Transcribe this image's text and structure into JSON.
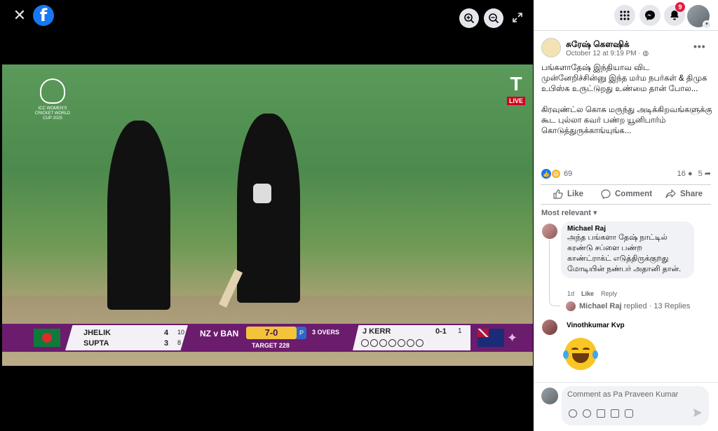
{
  "viewer": {
    "close_icon": "close-icon",
    "brand": "f",
    "photo": {
      "broadcast_logo": "ICC WOMEN'S CRICKET WORLD CUP 2025",
      "live_badge": "LIVE",
      "scorebar": {
        "batter1": {
          "name": "JHELIK",
          "runs": "4",
          "balls": "10"
        },
        "batter2": {
          "name": "SUPTA",
          "runs": "3",
          "balls": "8"
        },
        "match": "NZ v BAN",
        "score": "7-0",
        "powerplay": "P",
        "overs": "3 OVERS",
        "target": "TARGET 228",
        "bowler": {
          "name": "J KERR",
          "figures": "0-1",
          "overs": "1"
        }
      }
    }
  },
  "header": {
    "notifications_count": "9",
    "icons": [
      "menu-icon",
      "messenger-icon",
      "bell-icon"
    ]
  },
  "post": {
    "author": "சுரேஷ் கௌஷிக்",
    "timestamp": "October 12 at 9:19 PM",
    "privacy_icon": "globe-icon",
    "text": "பங்களாதேஷ் இந்தியாவ விட முன்னேறிச்சின்னு இந்த மர்ம நபர்கள் & திமுக உபிஸ்க உருட்டுறது உண்மை தான் போல...\n\nகிரவுண்ட்ல கொசு மருந்து அடிக்கிறவங்களுக்கு கூட புல்லா கவர் பண்ற யூனிபார்ம் கொடுத்துருக்காங்யுங்க...",
    "reaction_count": "69",
    "comment_count": "16",
    "share_count": "5",
    "actions": {
      "like": "Like",
      "comment": "Comment",
      "share": "Share"
    }
  },
  "comments": {
    "sort_label": "Most relevant",
    "items": [
      {
        "author": "Michael Raj",
        "text": "அந்த பங்களா தேஷ் நாட்டில் கரண்டு சப்ளை பண்ற காண்ட்ராக்ட் எடுத்திருக்குறது மோடியின் நண்பர் அதானி தான்.",
        "age": "1d",
        "like_label": "Like",
        "reply_label": "Reply",
        "reply_summary_name": "Michael Raj",
        "reply_summary_text": "replied · 13 Replies"
      },
      {
        "author": "Vinothkumar Kvp",
        "emoji": "laughing-with-tears-emoji"
      }
    ]
  },
  "composer": {
    "placeholder": "Comment as Pa Praveen Kumar"
  },
  "colors": {
    "facebook_blue": "#1877f2",
    "notification_red": "#e41e3f",
    "scorebar_purple": "#6b1c6d",
    "score_gold": "#f3c43a"
  }
}
